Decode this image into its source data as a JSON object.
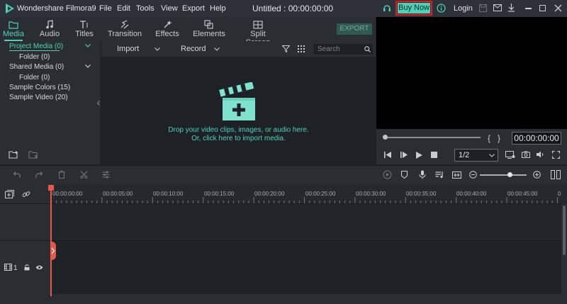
{
  "app": {
    "name": "Wondershare Filmora9",
    "menu": [
      "File",
      "Edit",
      "Tools",
      "View",
      "Export",
      "Help"
    ],
    "doc_title": "Untitled : 00:00:00:00",
    "buy_now": "Buy Now",
    "login": "Login",
    "accent_color": "#4fd0b4",
    "highlight_color": "#e01b24"
  },
  "tabs": [
    {
      "label": "Media",
      "icon": "folder-icon",
      "active": true
    },
    {
      "label": "Audio",
      "icon": "music-note-icon"
    },
    {
      "label": "Titles",
      "icon": "text-icon"
    },
    {
      "label": "Transition",
      "icon": "transition-icon"
    },
    {
      "label": "Effects",
      "icon": "effects-icon"
    },
    {
      "label": "Elements",
      "icon": "elements-icon"
    },
    {
      "label": "Split Screen",
      "icon": "split-screen-icon"
    }
  ],
  "export_label": "EXPORT",
  "library": {
    "items": [
      {
        "label": "Project Media (0)",
        "active": true
      },
      {
        "label": "Folder (0)"
      },
      {
        "label": "Shared Media (0)"
      },
      {
        "label": "Folder (0)"
      },
      {
        "label": "Sample Colors (15)"
      },
      {
        "label": "Sample Video (20)"
      }
    ]
  },
  "media": {
    "import_label": "Import",
    "record_label": "Record",
    "search_placeholder": "Search",
    "drop_line1": "Drop your video clips, images, or audio here.",
    "drop_line2": "Or, click here to import media."
  },
  "preview": {
    "timecode": "00:00:00:00",
    "quality": "1/2",
    "brackets": "{   }"
  },
  "timeline": {
    "ticks": [
      "00:00:00:00",
      "00:00:05:00",
      "00:00:10:00",
      "00:00:15:00",
      "00:00:20:00",
      "00:00:25:00",
      "00:00:30:00",
      "00:00:35:00",
      "00:00:40:00",
      "00:00:45:00",
      "0"
    ],
    "track_number": "1"
  }
}
